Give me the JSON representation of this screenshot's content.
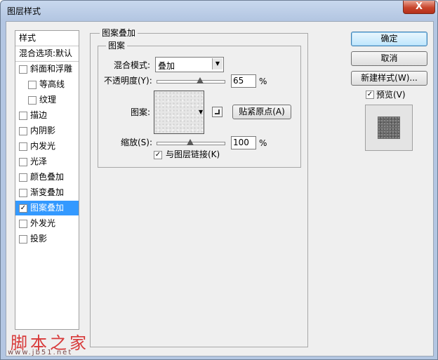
{
  "window": {
    "title": "图层样式",
    "close_glyph": "X"
  },
  "styles_list": {
    "header": "样式",
    "blending_options": "混合选项:默认",
    "items": [
      {
        "label": "斜面和浮雕",
        "checked": false,
        "indent": false,
        "selected": false
      },
      {
        "label": "等高线",
        "checked": false,
        "indent": true,
        "selected": false
      },
      {
        "label": "纹理",
        "checked": false,
        "indent": true,
        "selected": false
      },
      {
        "label": "描边",
        "checked": false,
        "indent": false,
        "selected": false
      },
      {
        "label": "内阴影",
        "checked": false,
        "indent": false,
        "selected": false
      },
      {
        "label": "内发光",
        "checked": false,
        "indent": false,
        "selected": false
      },
      {
        "label": "光泽",
        "checked": false,
        "indent": false,
        "selected": false
      },
      {
        "label": "颜色叠加",
        "checked": false,
        "indent": false,
        "selected": false
      },
      {
        "label": "渐变叠加",
        "checked": false,
        "indent": false,
        "selected": false
      },
      {
        "label": "图案叠加",
        "checked": true,
        "indent": false,
        "selected": true
      },
      {
        "label": "外发光",
        "checked": false,
        "indent": false,
        "selected": false
      },
      {
        "label": "投影",
        "checked": false,
        "indent": false,
        "selected": false
      }
    ]
  },
  "pattern_overlay": {
    "group_title": "图案叠加",
    "sub_group_title": "图案",
    "blend_mode_label": "混合模式:",
    "blend_mode_value": "叠加",
    "opacity_label": "不透明度(Y):",
    "opacity_value": "65",
    "opacity_fraction": 0.65,
    "percent": "%",
    "pattern_label": "图案:",
    "snap_origin_label": "贴紧原点(A)",
    "scale_label": "缩放(S):",
    "scale_value": "100",
    "scale_fraction": 0.5,
    "link_label": "与图层链接(K)",
    "link_checked": true
  },
  "buttons": {
    "ok": "确定",
    "cancel": "取消",
    "new_style": "新建样式(W)...",
    "preview_label": "预览(V)",
    "preview_checked": true
  },
  "watermark": {
    "text": "脚本之家",
    "url": "www.jb51.net"
  }
}
